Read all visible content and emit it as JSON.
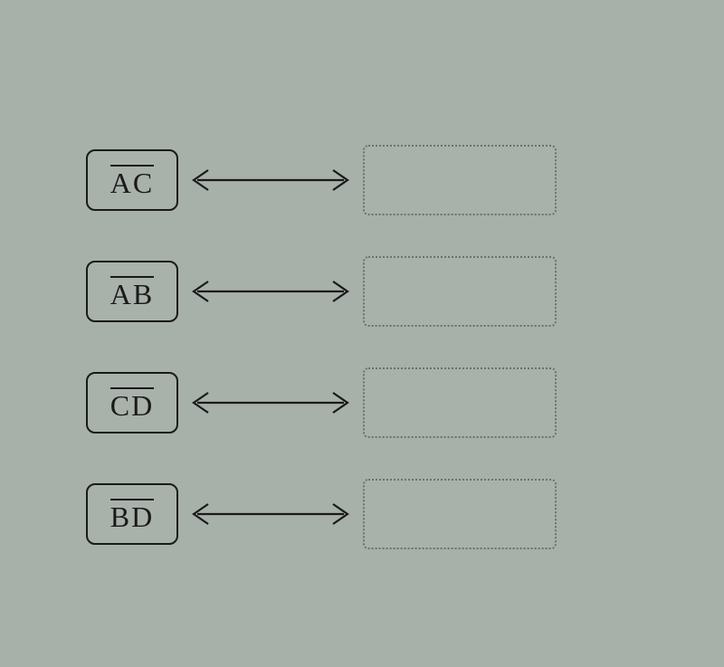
{
  "rows": [
    {
      "label": "AC"
    },
    {
      "label": "AB"
    },
    {
      "label": "CD"
    },
    {
      "label": "BD"
    }
  ]
}
